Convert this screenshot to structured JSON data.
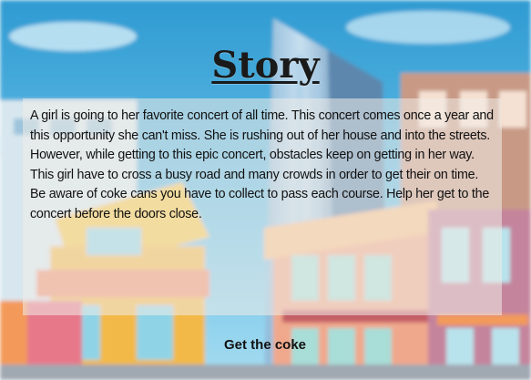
{
  "header": {
    "title": "Story"
  },
  "story": {
    "text": "A girl is going to her favorite concert of all time. This concert comes once a year and this opportunity she can't miss. She is rushing out of her house and into the streets. However, while getting to this epic concert, obstacles keep on getting in her way. This girl have to cross a busy road and many crowds in order to get their on time. Be aware of coke cans you have to collect to pass each course. Help her get to the concert before the doors close."
  },
  "actions": {
    "start_label": "Get the coke"
  },
  "colors": {
    "sky": "#3aa3d6",
    "panel": "#f0ece8",
    "text": "#111111"
  }
}
